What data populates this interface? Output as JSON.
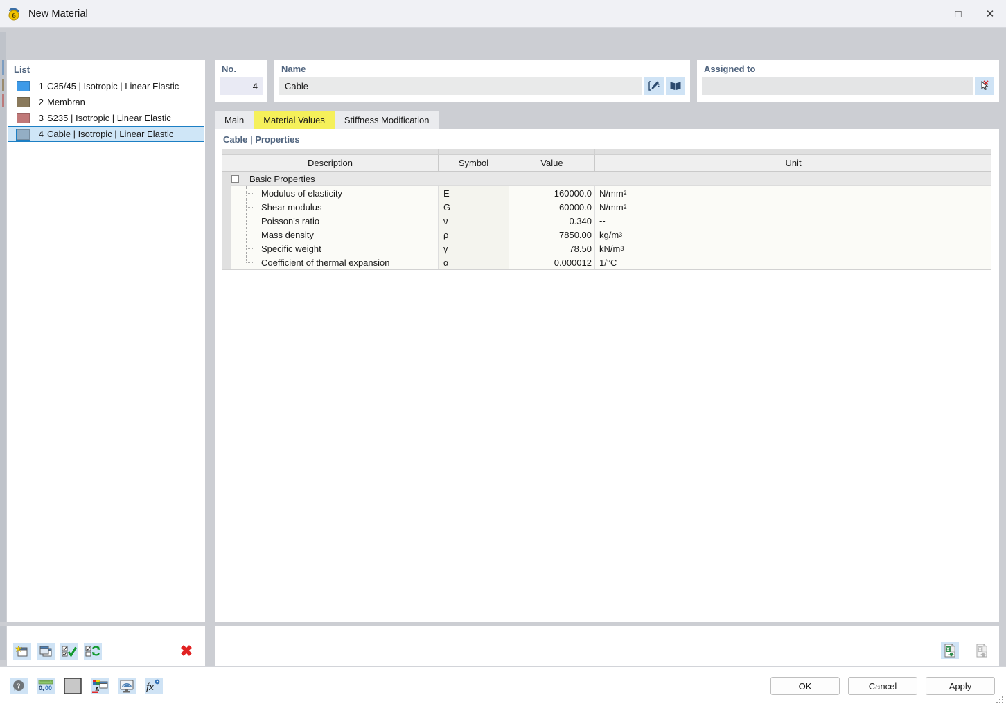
{
  "window": {
    "title": "New Material",
    "app_icon": "material-6-icon",
    "controls": {
      "minimize": "—",
      "maximize": "□",
      "close": "✕"
    }
  },
  "sidebar": {
    "label": "List",
    "items": [
      {
        "no": "1",
        "name": "C35/45 | Isotropic | Linear Elastic",
        "color": "#3d9ae8",
        "selected": false
      },
      {
        "no": "2",
        "name": "Membran",
        "color": "#8a7a5c",
        "selected": false
      },
      {
        "no": "3",
        "name": "S235 | Isotropic | Linear Elastic",
        "color": "#c07878",
        "selected": false
      },
      {
        "no": "4",
        "name": "Cable | Isotropic | Linear Elastic",
        "color": "#93aec4",
        "selected": true
      }
    ],
    "toolbar": [
      {
        "name": "new-material-icon",
        "tip": "New"
      },
      {
        "name": "copy-material-icon",
        "tip": "Copy"
      },
      {
        "name": "select-all-icon",
        "tip": "Select All"
      },
      {
        "name": "invert-selection-icon",
        "tip": "Invert Selection"
      },
      {
        "name": "delete-material-icon",
        "tip": "Delete",
        "glyph": "✖"
      }
    ]
  },
  "header": {
    "no": {
      "label": "No.",
      "value": "4"
    },
    "name": {
      "label": "Name",
      "value": "Cable",
      "placeholder": "",
      "buttons": [
        {
          "name": "edit-name-icon"
        },
        {
          "name": "material-library-icon"
        }
      ]
    },
    "assigned_to": {
      "label": "Assigned to",
      "value": "",
      "placeholder": "",
      "buttons": [
        {
          "name": "pick-objects-icon"
        }
      ]
    }
  },
  "tabs": [
    {
      "label": "Main",
      "active": false,
      "highlight": false
    },
    {
      "label": "Material Values",
      "active": true,
      "highlight": true
    },
    {
      "label": "Stiffness Modification",
      "active": false,
      "highlight": false
    }
  ],
  "content": {
    "title": "Cable | Properties",
    "columns": [
      "Description",
      "Symbol",
      "Value",
      "Unit"
    ],
    "groups": [
      {
        "label": "Basic Properties",
        "expanded": true,
        "rows": [
          {
            "description": "Modulus of elasticity",
            "symbol": "E",
            "value": "160000.0",
            "unit": "N/mm",
            "unit_sup": "2"
          },
          {
            "description": "Shear modulus",
            "symbol": "G",
            "value": "60000.0",
            "unit": "N/mm",
            "unit_sup": "2"
          },
          {
            "description": "Poisson's ratio",
            "symbol": "ν",
            "value": "0.340",
            "unit": "--",
            "unit_sup": ""
          },
          {
            "description": "Mass density",
            "symbol": "ρ",
            "value": "7850.00",
            "unit": "kg/m",
            "unit_sup": "3"
          },
          {
            "description": "Specific weight",
            "symbol": "γ",
            "value": "78.50",
            "unit": "kN/m",
            "unit_sup": "3"
          },
          {
            "description": "Coefficient of thermal expansion",
            "symbol": "α",
            "value": "0.000012",
            "unit": "1/°C",
            "unit_sup": ""
          }
        ]
      }
    ],
    "tools": [
      {
        "name": "excel-import-icon",
        "enabled": true
      },
      {
        "name": "excel-export-icon",
        "enabled": false
      }
    ]
  },
  "statusbar": {
    "icons": [
      {
        "name": "help-icon"
      },
      {
        "name": "units-decimal-places-icon",
        "text": "0,00"
      },
      {
        "name": "color-swatch-icon",
        "color": "#c8c8c8"
      },
      {
        "name": "appearance-colors-icon"
      },
      {
        "name": "display-render-icon"
      },
      {
        "name": "formula-fx-icon",
        "text": "f"
      }
    ],
    "buttons": [
      {
        "label": "OK",
        "name": "ok-button"
      },
      {
        "label": "Cancel",
        "name": "cancel-button"
      },
      {
        "label": "Apply",
        "name": "apply-button"
      }
    ]
  },
  "colors": {
    "accent": "#51657f",
    "highlight": "#f5f05a",
    "selection": "#cfe6f7",
    "selection_border": "#1d7fc4",
    "icon_back": "#cfe3f5",
    "delete_red": "#e12222"
  }
}
